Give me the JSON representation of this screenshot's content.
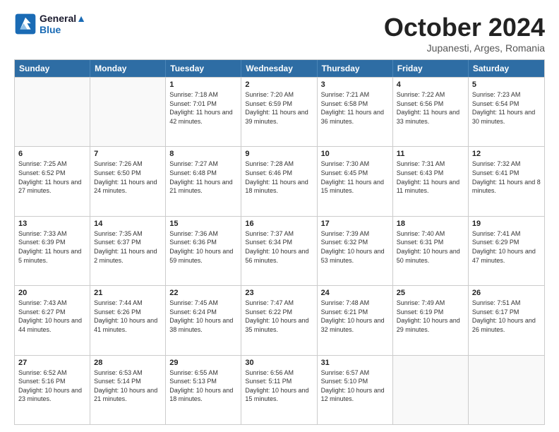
{
  "logo": {
    "line1": "General",
    "line2": "Blue"
  },
  "title": "October 2024",
  "subtitle": "Jupanesti, Arges, Romania",
  "header_days": [
    "Sunday",
    "Monday",
    "Tuesday",
    "Wednesday",
    "Thursday",
    "Friday",
    "Saturday"
  ],
  "weeks": [
    [
      {
        "day": "",
        "info": ""
      },
      {
        "day": "",
        "info": ""
      },
      {
        "day": "1",
        "info": "Sunrise: 7:18 AM\nSunset: 7:01 PM\nDaylight: 11 hours and 42 minutes."
      },
      {
        "day": "2",
        "info": "Sunrise: 7:20 AM\nSunset: 6:59 PM\nDaylight: 11 hours and 39 minutes."
      },
      {
        "day": "3",
        "info": "Sunrise: 7:21 AM\nSunset: 6:58 PM\nDaylight: 11 hours and 36 minutes."
      },
      {
        "day": "4",
        "info": "Sunrise: 7:22 AM\nSunset: 6:56 PM\nDaylight: 11 hours and 33 minutes."
      },
      {
        "day": "5",
        "info": "Sunrise: 7:23 AM\nSunset: 6:54 PM\nDaylight: 11 hours and 30 minutes."
      }
    ],
    [
      {
        "day": "6",
        "info": "Sunrise: 7:25 AM\nSunset: 6:52 PM\nDaylight: 11 hours and 27 minutes."
      },
      {
        "day": "7",
        "info": "Sunrise: 7:26 AM\nSunset: 6:50 PM\nDaylight: 11 hours and 24 minutes."
      },
      {
        "day": "8",
        "info": "Sunrise: 7:27 AM\nSunset: 6:48 PM\nDaylight: 11 hours and 21 minutes."
      },
      {
        "day": "9",
        "info": "Sunrise: 7:28 AM\nSunset: 6:46 PM\nDaylight: 11 hours and 18 minutes."
      },
      {
        "day": "10",
        "info": "Sunrise: 7:30 AM\nSunset: 6:45 PM\nDaylight: 11 hours and 15 minutes."
      },
      {
        "day": "11",
        "info": "Sunrise: 7:31 AM\nSunset: 6:43 PM\nDaylight: 11 hours and 11 minutes."
      },
      {
        "day": "12",
        "info": "Sunrise: 7:32 AM\nSunset: 6:41 PM\nDaylight: 11 hours and 8 minutes."
      }
    ],
    [
      {
        "day": "13",
        "info": "Sunrise: 7:33 AM\nSunset: 6:39 PM\nDaylight: 11 hours and 5 minutes."
      },
      {
        "day": "14",
        "info": "Sunrise: 7:35 AM\nSunset: 6:37 PM\nDaylight: 11 hours and 2 minutes."
      },
      {
        "day": "15",
        "info": "Sunrise: 7:36 AM\nSunset: 6:36 PM\nDaylight: 10 hours and 59 minutes."
      },
      {
        "day": "16",
        "info": "Sunrise: 7:37 AM\nSunset: 6:34 PM\nDaylight: 10 hours and 56 minutes."
      },
      {
        "day": "17",
        "info": "Sunrise: 7:39 AM\nSunset: 6:32 PM\nDaylight: 10 hours and 53 minutes."
      },
      {
        "day": "18",
        "info": "Sunrise: 7:40 AM\nSunset: 6:31 PM\nDaylight: 10 hours and 50 minutes."
      },
      {
        "day": "19",
        "info": "Sunrise: 7:41 AM\nSunset: 6:29 PM\nDaylight: 10 hours and 47 minutes."
      }
    ],
    [
      {
        "day": "20",
        "info": "Sunrise: 7:43 AM\nSunset: 6:27 PM\nDaylight: 10 hours and 44 minutes."
      },
      {
        "day": "21",
        "info": "Sunrise: 7:44 AM\nSunset: 6:26 PM\nDaylight: 10 hours and 41 minutes."
      },
      {
        "day": "22",
        "info": "Sunrise: 7:45 AM\nSunset: 6:24 PM\nDaylight: 10 hours and 38 minutes."
      },
      {
        "day": "23",
        "info": "Sunrise: 7:47 AM\nSunset: 6:22 PM\nDaylight: 10 hours and 35 minutes."
      },
      {
        "day": "24",
        "info": "Sunrise: 7:48 AM\nSunset: 6:21 PM\nDaylight: 10 hours and 32 minutes."
      },
      {
        "day": "25",
        "info": "Sunrise: 7:49 AM\nSunset: 6:19 PM\nDaylight: 10 hours and 29 minutes."
      },
      {
        "day": "26",
        "info": "Sunrise: 7:51 AM\nSunset: 6:17 PM\nDaylight: 10 hours and 26 minutes."
      }
    ],
    [
      {
        "day": "27",
        "info": "Sunrise: 6:52 AM\nSunset: 5:16 PM\nDaylight: 10 hours and 23 minutes."
      },
      {
        "day": "28",
        "info": "Sunrise: 6:53 AM\nSunset: 5:14 PM\nDaylight: 10 hours and 21 minutes."
      },
      {
        "day": "29",
        "info": "Sunrise: 6:55 AM\nSunset: 5:13 PM\nDaylight: 10 hours and 18 minutes."
      },
      {
        "day": "30",
        "info": "Sunrise: 6:56 AM\nSunset: 5:11 PM\nDaylight: 10 hours and 15 minutes."
      },
      {
        "day": "31",
        "info": "Sunrise: 6:57 AM\nSunset: 5:10 PM\nDaylight: 10 hours and 12 minutes."
      },
      {
        "day": "",
        "info": ""
      },
      {
        "day": "",
        "info": ""
      }
    ]
  ]
}
